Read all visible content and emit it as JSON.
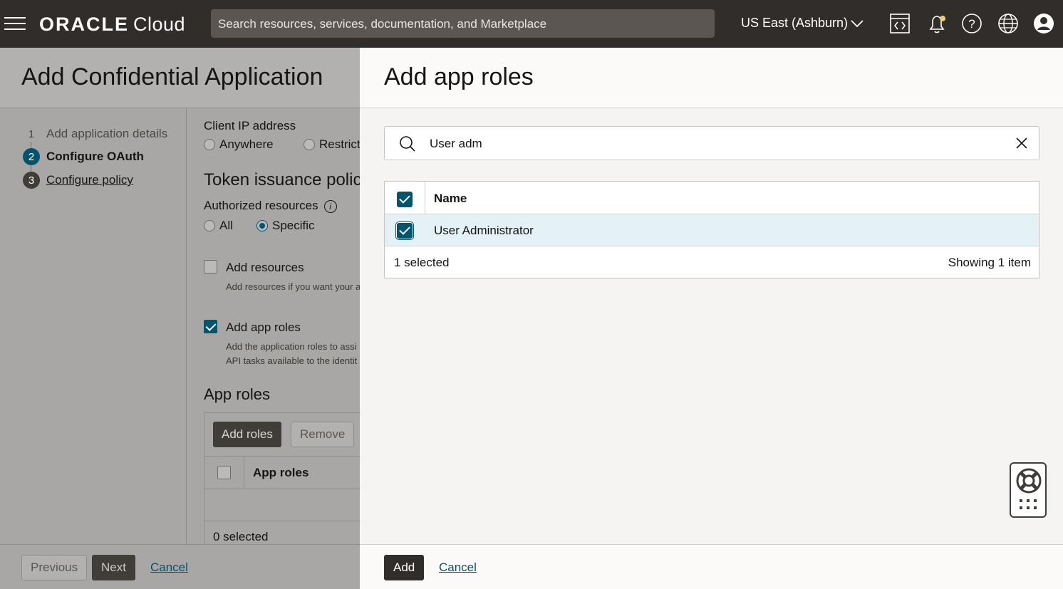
{
  "topbar": {
    "menu_icon": "hamburger-icon",
    "brand": "ORACLE",
    "product": "Cloud",
    "search_placeholder": "Search resources, services, documentation, and Marketplace",
    "region": "US East (Ashburn)",
    "icons": [
      "cloud-shell-icon",
      "bell-icon",
      "help-icon",
      "globe-icon",
      "profile-icon"
    ]
  },
  "background_page": {
    "title": "Add Confidential Application",
    "steps": [
      {
        "num": "1",
        "label": "Add application details"
      },
      {
        "num": "2",
        "label": "Configure OAuth"
      },
      {
        "num": "3",
        "label": "Configure policy"
      }
    ],
    "client_ip_label": "Client IP address",
    "client_ip_options": [
      "Anywhere",
      "Restrict"
    ],
    "token_heading": "Token issuance polic",
    "authorized_resources_label": "Authorized resources",
    "authorized_options": [
      "All",
      "Specific"
    ],
    "add_resources_label": "Add resources",
    "add_resources_help": "Add resources if you want your a",
    "add_app_roles_label": "Add app roles",
    "add_app_roles_help_1": "Add the application roles to assi",
    "add_app_roles_help_2": "API tasks available to the identit",
    "app_roles_heading": "App roles",
    "add_roles_button": "Add roles",
    "remove_button": "Remove",
    "app_roles_column": "App roles",
    "selected_text": "0 selected",
    "previous_button": "Previous",
    "next_button": "Next",
    "cancel_link": "Cancel"
  },
  "panel": {
    "title": "Add app roles",
    "search_value": "User adm",
    "column_name": "Name",
    "rows": [
      {
        "name": "User Administrator",
        "checked": true
      }
    ],
    "selected_count": "1 selected",
    "showing": "Showing 1 item",
    "add_button": "Add",
    "cancel_link": "Cancel"
  },
  "colors": {
    "topbar": "#312d2a",
    "accent": "#04536f",
    "selected_row": "#e4f1f6"
  }
}
